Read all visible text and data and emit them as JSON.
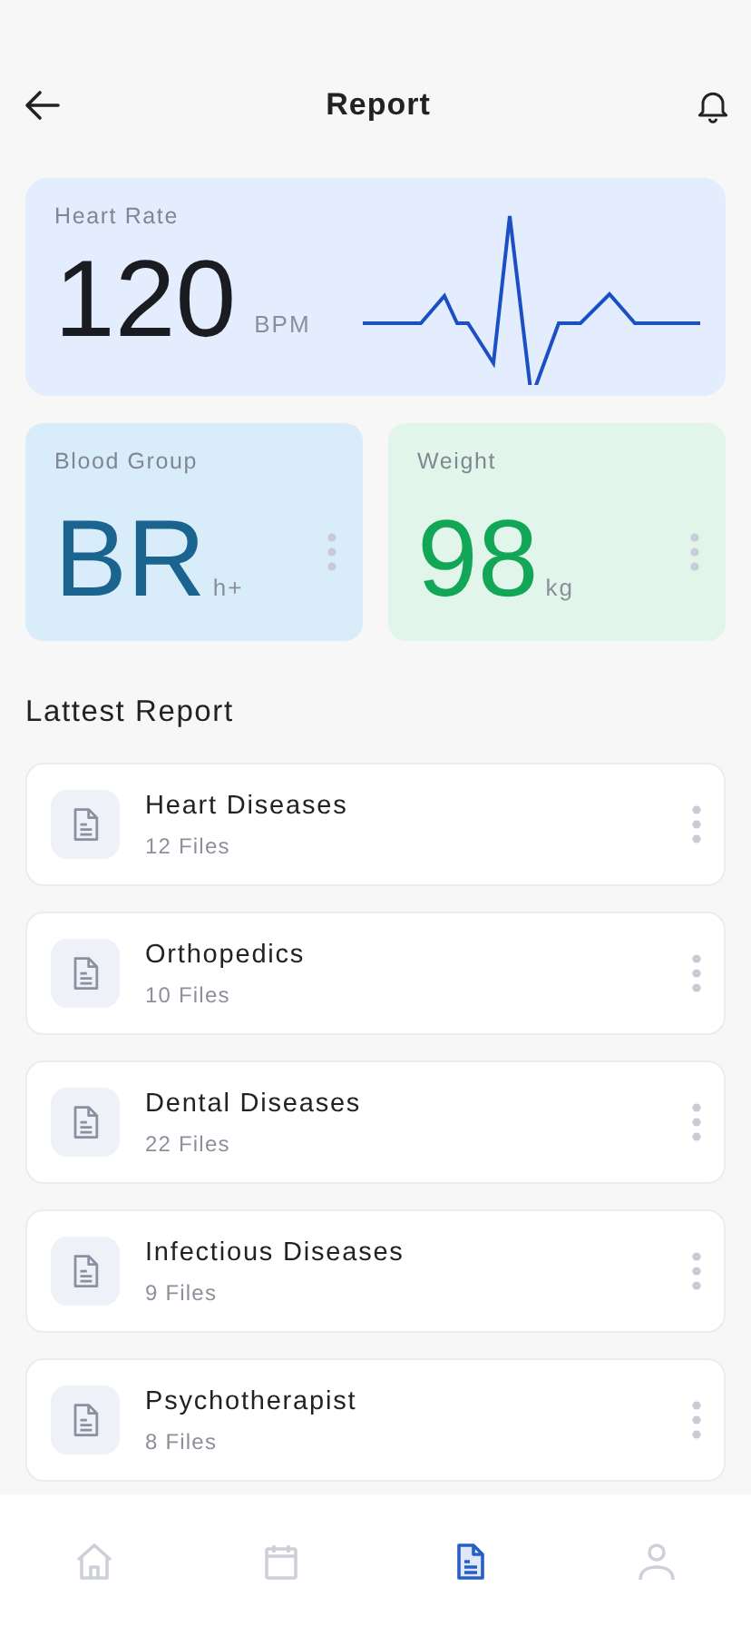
{
  "header": {
    "title": "Report"
  },
  "heart_rate": {
    "label": "Heart Rate",
    "value": "120",
    "unit": "BPM"
  },
  "stats": [
    {
      "kind": "blood",
      "label": "Blood Group",
      "value": "BR",
      "unit": "h+"
    },
    {
      "kind": "weight",
      "label": "Weight",
      "value": "98",
      "unit": "kg"
    }
  ],
  "section_title": "Lattest Report",
  "reports": [
    {
      "title": "Heart Diseases",
      "count": "12 Files"
    },
    {
      "title": "Orthopedics",
      "count": "10 Files"
    },
    {
      "title": "Dental Diseases",
      "count": "22 Files"
    },
    {
      "title": "Infectious Diseases",
      "count": "9 Files"
    },
    {
      "title": "Psychotherapist",
      "count": "8 Files"
    }
  ],
  "nav": [
    {
      "kind": "home",
      "selected": false
    },
    {
      "kind": "calendar",
      "selected": false
    },
    {
      "kind": "report",
      "selected": true
    },
    {
      "kind": "profile",
      "selected": false
    }
  ]
}
